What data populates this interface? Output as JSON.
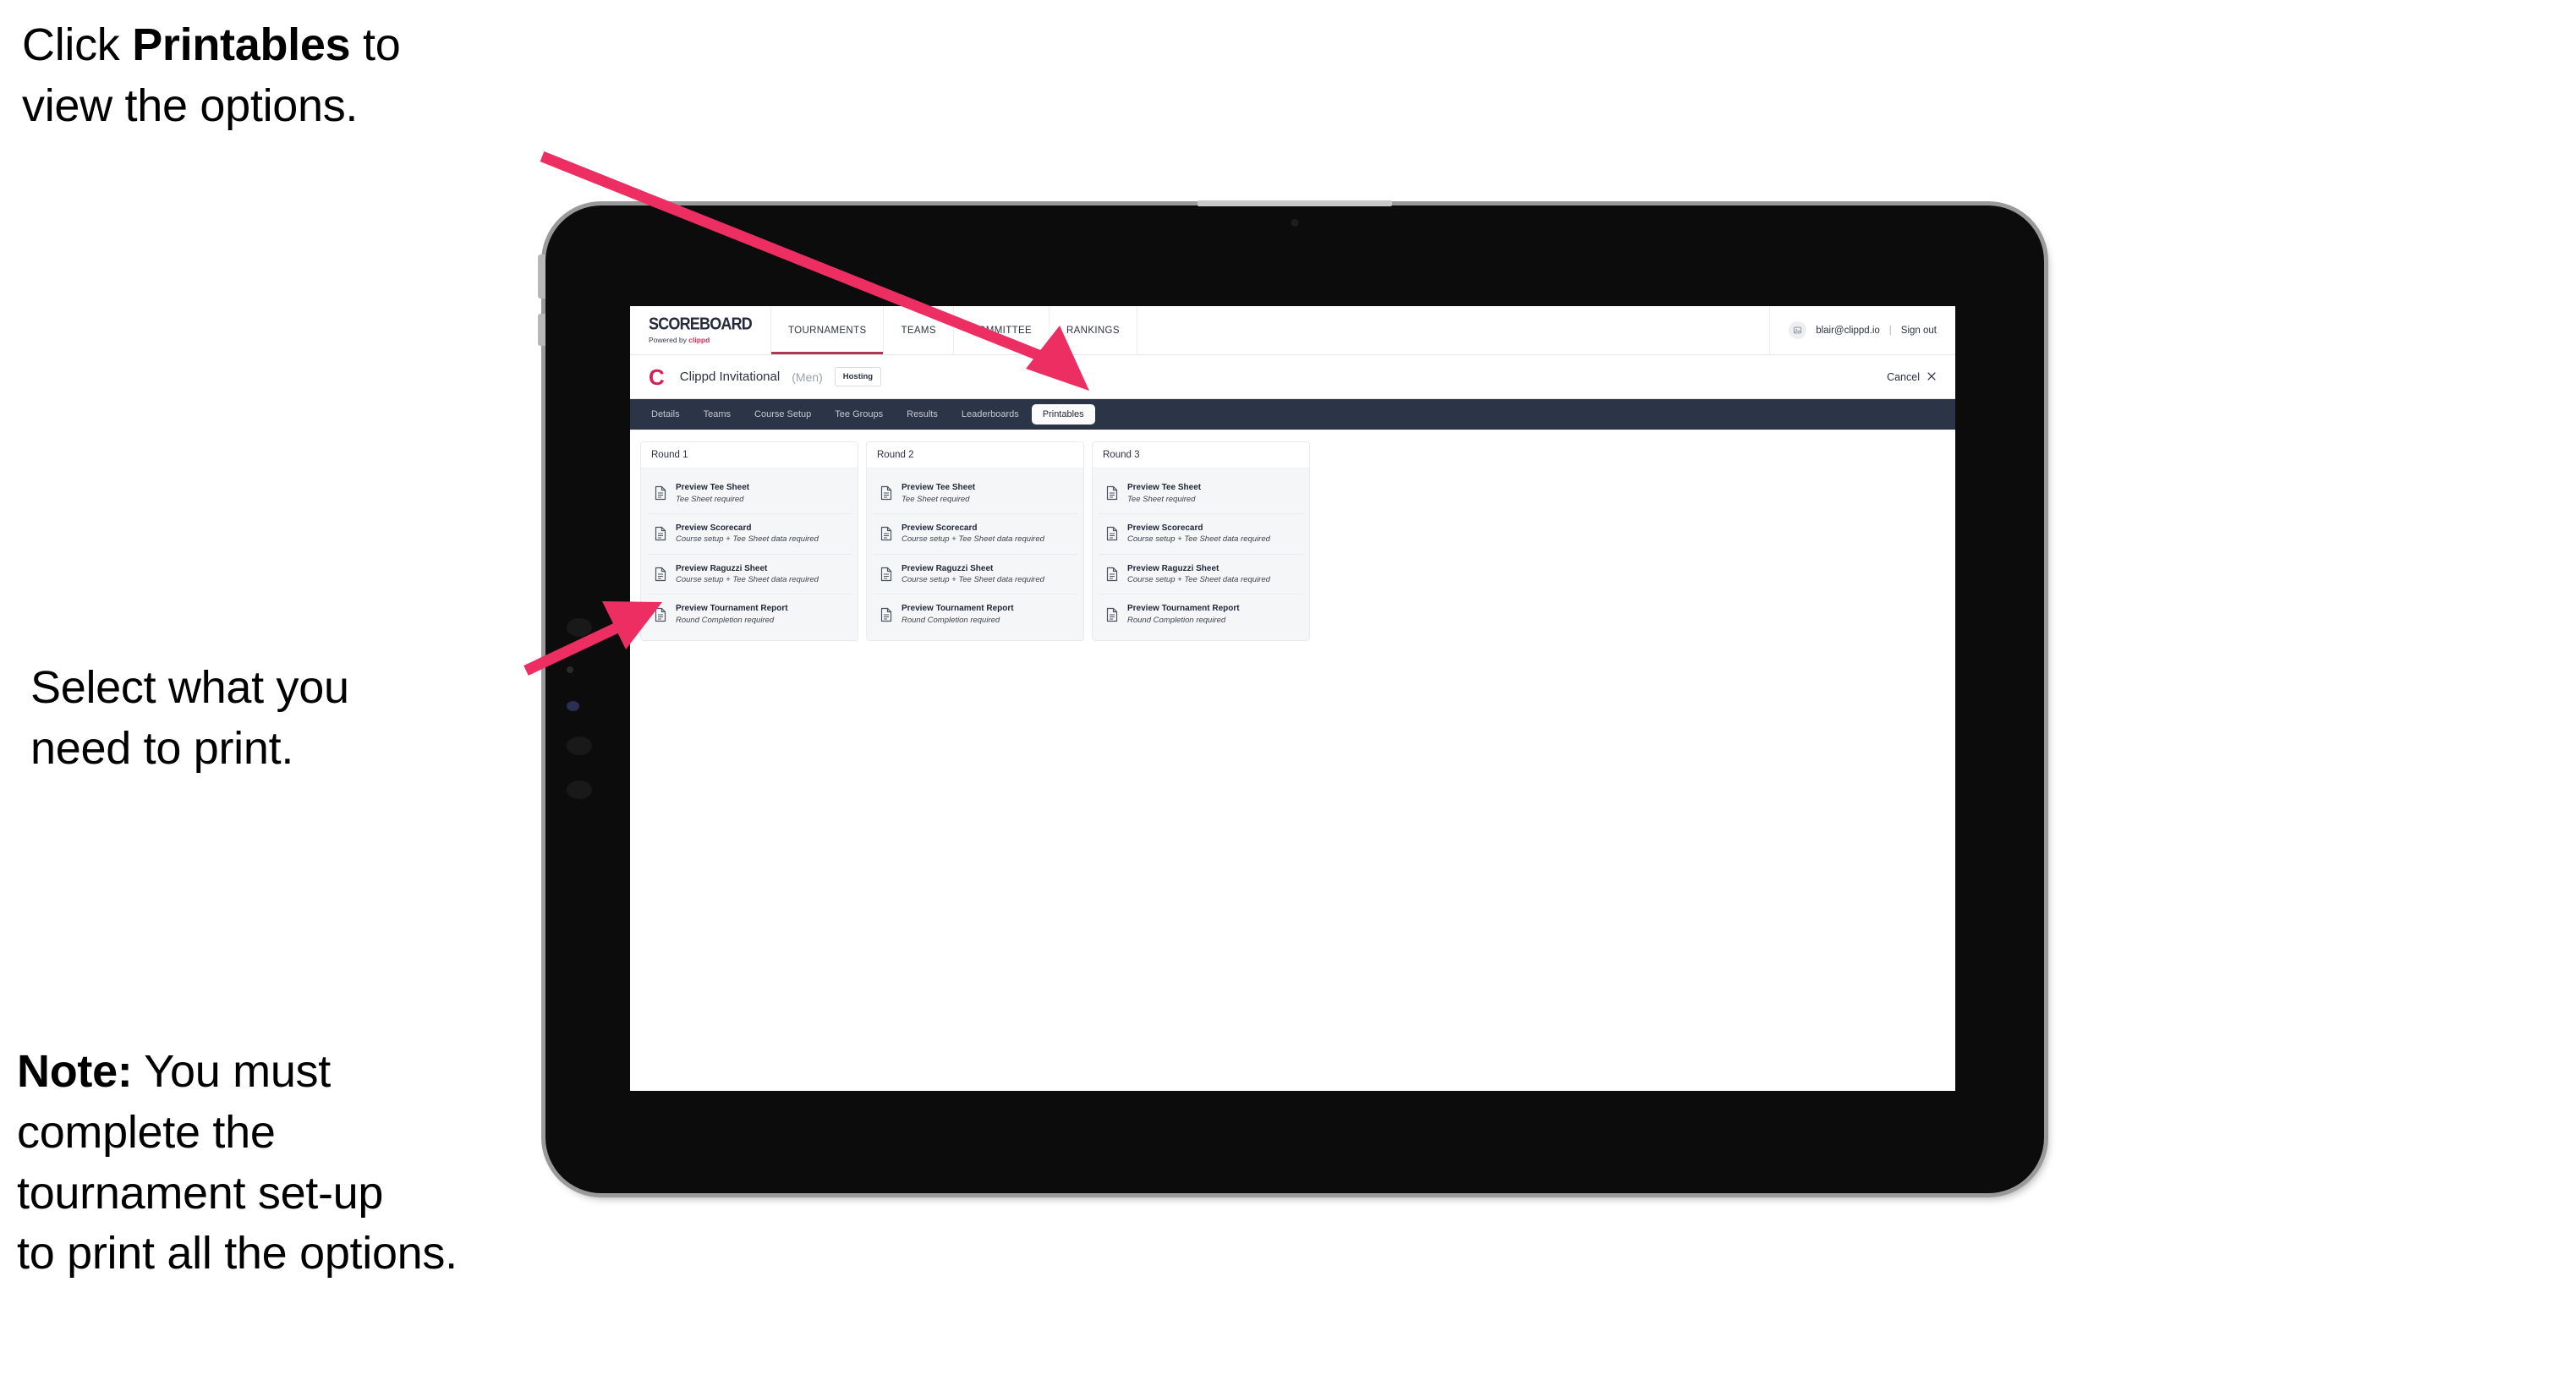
{
  "annotations": {
    "click_printables": {
      "prefix": "Click ",
      "bold": "Printables",
      "suffix": " to\nview the options."
    },
    "select_print": "Select what you\n need to print.",
    "note": {
      "bold": "Note:",
      "text": " You must\ncomplete the\ntournament set-up\nto print all the options."
    }
  },
  "colors": {
    "arrow_pink": "#ED2E63",
    "tabstrip_navy": "#2C3447",
    "brand_red": "#E8275A",
    "clippd_crimson": "#D81E55"
  },
  "topnav": {
    "brand_title": "SCOREBOARD",
    "brand_sub_prefix": "Powered by ",
    "brand_sub_word": "clippd",
    "links": [
      {
        "label": "TOURNAMENTS",
        "active": true
      },
      {
        "label": "TEAMS",
        "active": false
      },
      {
        "label": "COMMITTEE",
        "active": false
      },
      {
        "label": "RANKINGS",
        "active": false
      }
    ],
    "avatar_icon": "user-avatar-icon",
    "user_email": "blair@clippd.io",
    "divider": "|",
    "sign_out": "Sign out"
  },
  "tournament_header": {
    "logo_letter": "C",
    "name": "Clippd Invitational",
    "gender": "(Men)",
    "badge": "Hosting",
    "cancel_label": "Cancel",
    "cancel_icon": "close-x-icon"
  },
  "tabs": [
    {
      "label": "Details",
      "active": false
    },
    {
      "label": "Teams",
      "active": false
    },
    {
      "label": "Course Setup",
      "active": false
    },
    {
      "label": "Tee Groups",
      "active": false
    },
    {
      "label": "Results",
      "active": false
    },
    {
      "label": "Leaderboards",
      "active": false
    },
    {
      "label": "Printables",
      "active": true
    }
  ],
  "rounds": [
    {
      "title": "Round 1",
      "printables": [
        {
          "title": "Preview Tee Sheet",
          "requirement": "Tee Sheet required",
          "icon": "document-icon"
        },
        {
          "title": "Preview Scorecard",
          "requirement": "Course setup + Tee Sheet data required",
          "icon": "document-icon"
        },
        {
          "title": "Preview Raguzzi Sheet",
          "requirement": "Course setup + Tee Sheet data required",
          "icon": "document-icon"
        },
        {
          "title": "Preview Tournament Report",
          "requirement": "Round Completion required",
          "icon": "document-icon"
        }
      ]
    },
    {
      "title": "Round 2",
      "printables": [
        {
          "title": "Preview Tee Sheet",
          "requirement": "Tee Sheet required",
          "icon": "document-icon"
        },
        {
          "title": "Preview Scorecard",
          "requirement": "Course setup + Tee Sheet data required",
          "icon": "document-icon"
        },
        {
          "title": "Preview Raguzzi Sheet",
          "requirement": "Course setup + Tee Sheet data required",
          "icon": "document-icon"
        },
        {
          "title": "Preview Tournament Report",
          "requirement": "Round Completion required",
          "icon": "document-icon"
        }
      ]
    },
    {
      "title": "Round 3",
      "printables": [
        {
          "title": "Preview Tee Sheet",
          "requirement": "Tee Sheet required",
          "icon": "document-icon"
        },
        {
          "title": "Preview Scorecard",
          "requirement": "Course setup + Tee Sheet data required",
          "icon": "document-icon"
        },
        {
          "title": "Preview Raguzzi Sheet",
          "requirement": "Course setup + Tee Sheet data required",
          "icon": "document-icon"
        },
        {
          "title": "Preview Tournament Report",
          "requirement": "Round Completion required",
          "icon": "document-icon"
        }
      ]
    }
  ]
}
